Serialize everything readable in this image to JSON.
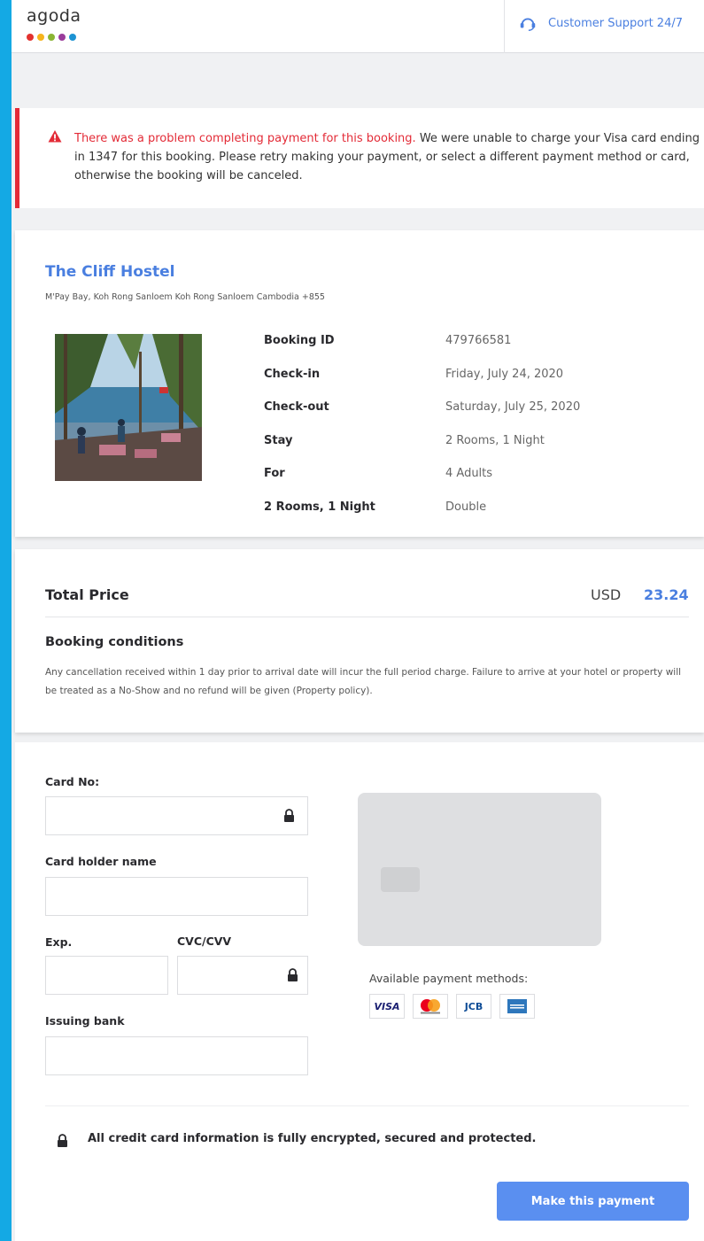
{
  "header": {
    "logo_text": "agoda",
    "logo_dot_colors": [
      "#e3322f",
      "#f6b41c",
      "#8ab533",
      "#9a3c9b",
      "#1c93d3"
    ],
    "support_label": "Customer Support 24/7"
  },
  "alert": {
    "highlight": "There was a problem completing payment for this booking.",
    "message": " We were unable to charge your Visa card ending in 1347 for this booking. Please retry making your payment, or select a different payment method or card, otherwise the booking will be canceled."
  },
  "hotel": {
    "name": "The Cliff Hostel",
    "address": "M'Pay Bay, Koh Rong Sanloem Koh Rong Sanloem Cambodia +855",
    "details": [
      {
        "label": "Booking ID",
        "value": "479766581"
      },
      {
        "label": "Check-in",
        "value": "Friday, July 24, 2020"
      },
      {
        "label": "Check-out",
        "value": "Saturday, July 25, 2020"
      },
      {
        "label": "Stay",
        "value": "2 Rooms, 1 Night"
      },
      {
        "label": "For",
        "value": "4 Adults"
      },
      {
        "label": "2 Rooms, 1 Night",
        "value": "Double"
      }
    ]
  },
  "price": {
    "total_label": "Total Price",
    "currency": "USD",
    "amount": "23.24",
    "conditions_title": "Booking conditions",
    "conditions_text": "Any cancellation received within 1 day prior to arrival date will incur the full period charge. Failure to arrive at your hotel or property will be treated as a No-Show and no refund will be given (Property policy)."
  },
  "payment": {
    "card_no_label": "Card No:",
    "card_no_value": "",
    "holder_label": "Card holder name",
    "holder_value": "",
    "exp_label": "Exp.",
    "exp_value": "",
    "cvc_label": "CVC/CVV",
    "cvc_value": "",
    "bank_label": "Issuing bank",
    "bank_value": "",
    "methods_label": "Available payment methods:",
    "brands": [
      "VISA",
      "JCB"
    ],
    "secure_note": "All credit card information is fully encrypted, secured and protected.",
    "pay_button": "Make this payment"
  },
  "colors": {
    "accent_blue": "#4a7fe0",
    "error_red": "#e32b37",
    "side_bar": "#14a9e4",
    "button": "#5a8ff0"
  }
}
